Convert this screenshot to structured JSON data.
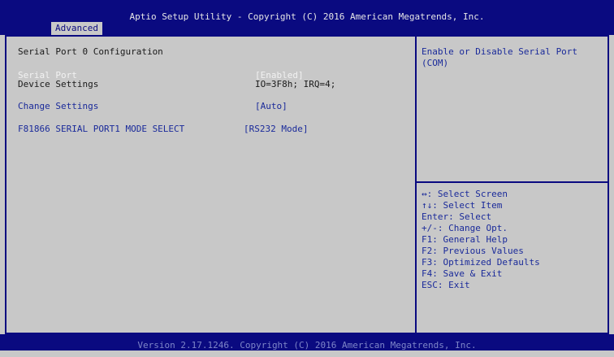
{
  "header": {
    "title": "Aptio Setup Utility - Copyright (C) 2016 American Megatrends, Inc.",
    "tab": "Advanced"
  },
  "main": {
    "section_title": "Serial Port 0 Configuration",
    "rows": [
      {
        "label": "Serial Port",
        "value": "[Enabled]"
      },
      {
        "label": "Device Settings",
        "value": "IO=3F8h; IRQ=4;"
      },
      {
        "label": "Change Settings",
        "value": "[Auto]"
      },
      {
        "label": "F81866 SERIAL PORT1 MODE SELECT",
        "value": "[RS232 Mode]"
      }
    ]
  },
  "help": {
    "text": "Enable or Disable Serial Port (COM)",
    "keys": [
      "↔: Select Screen",
      "↑↓: Select Item",
      "Enter: Select",
      "+/-: Change Opt.",
      "F1: General Help",
      "F2: Previous Values",
      "F3: Optimized Defaults",
      "F4: Save & Exit",
      "ESC: Exit"
    ]
  },
  "footer": {
    "text": "Version 2.17.1246. Copyright (C) 2016 American Megatrends, Inc."
  },
  "colors": {
    "header_bg": "#0a0a80",
    "body_bg": "#c8c8c8",
    "selectable_text": "#1a2a9a",
    "highlight_text": "#f2f2f2"
  }
}
